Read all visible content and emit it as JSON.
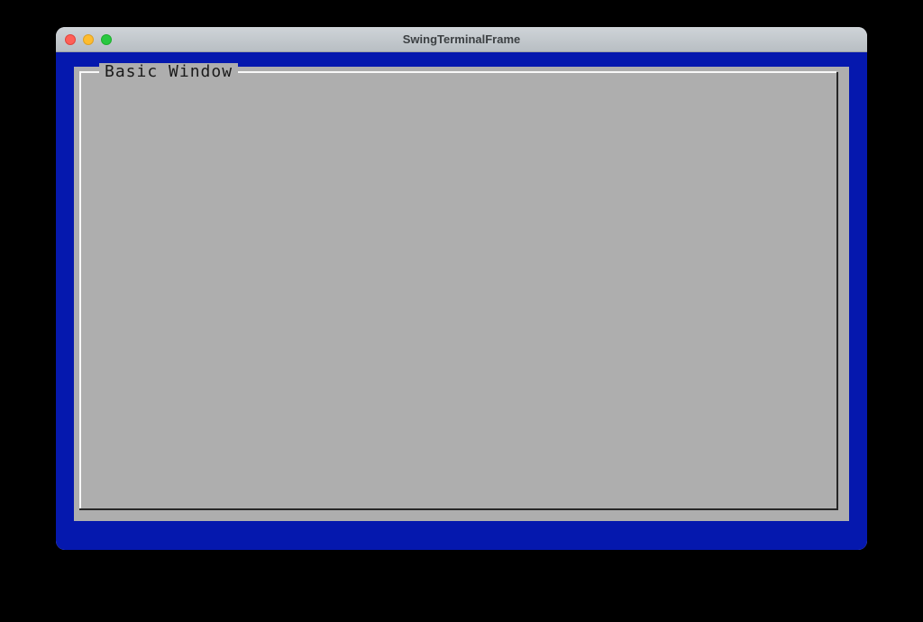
{
  "window": {
    "title": "SwingTerminalFrame"
  },
  "terminal": {
    "background_color": "#0518ae"
  },
  "tui": {
    "window_title": "Basic Window"
  }
}
